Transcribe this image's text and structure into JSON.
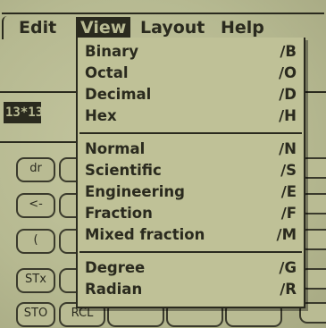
{
  "menubar": {
    "edit": "Edit",
    "view": "View",
    "layout": "Layout",
    "help": "Help"
  },
  "display": {
    "value": "13*13"
  },
  "keys": {
    "dr": "dr",
    "back": "<-",
    "paren": "(",
    "stx": "STx",
    "sto": "STO",
    "rcl": "RCL"
  },
  "view_menu": {
    "groups": [
      [
        {
          "label": "Binary",
          "shortcut": "∕B"
        },
        {
          "label": "Octal",
          "shortcut": "∕O"
        },
        {
          "label": "Decimal",
          "shortcut": "∕D"
        },
        {
          "label": "Hex",
          "shortcut": "∕H"
        }
      ],
      [
        {
          "label": "Normal",
          "shortcut": "∕N"
        },
        {
          "label": "Scientific",
          "shortcut": "∕S"
        },
        {
          "label": "Engineering",
          "shortcut": "∕E"
        },
        {
          "label": "Fraction",
          "shortcut": "∕F"
        },
        {
          "label": "Mixed fraction",
          "shortcut": "∕M"
        }
      ],
      [
        {
          "label": "Degree",
          "shortcut": "∕G"
        },
        {
          "label": "Radian",
          "shortcut": "∕R"
        }
      ]
    ]
  },
  "colors": {
    "lcd_background": "#b9bb93",
    "lcd_ink": "#2a2a1e"
  }
}
